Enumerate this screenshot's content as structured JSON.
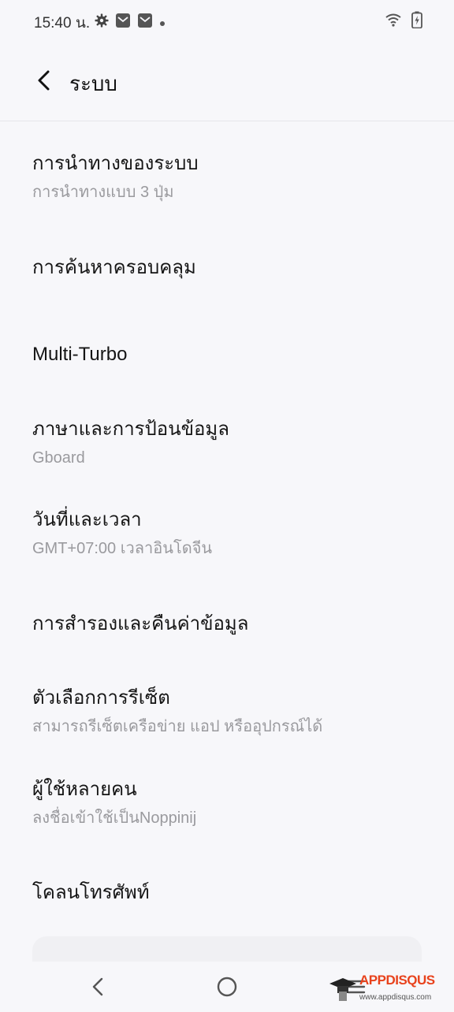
{
  "status_bar": {
    "time": "15:40 น.",
    "icons_left": [
      "gear-icon",
      "mail-icon",
      "mail-icon",
      "dot-icon"
    ],
    "icons_right": [
      "wifi-icon",
      "battery-charging-icon"
    ]
  },
  "header": {
    "back_icon": "chevron-left-icon",
    "title": "ระบบ"
  },
  "settings": [
    {
      "title": "การนำทางของระบบ",
      "subtitle": "การนำทางแบบ 3 ปุ่ม"
    },
    {
      "title": "การค้นหาครอบคลุม",
      "subtitle": ""
    },
    {
      "title": "Multi-Turbo",
      "subtitle": ""
    },
    {
      "title": "ภาษาและการป้อนข้อมูล",
      "subtitle": "Gboard"
    },
    {
      "title": "วันที่และเวลา",
      "subtitle": "GMT+07:00 เวลาอินโดจีน"
    },
    {
      "title": "การสำรองและคืนค่าข้อมูล",
      "subtitle": ""
    },
    {
      "title": "ตัวเลือกการรีเซ็ต",
      "subtitle": "สามารถรีเซ็ตเครือข่าย แอป หรืออุปกรณ์ได้"
    },
    {
      "title": "ผู้ใช้หลายคน",
      "subtitle": "ลงชื่อเข้าใช้เป็นNoppinij"
    },
    {
      "title": "โคลนโทรศัพท์",
      "subtitle": ""
    }
  ],
  "nav_bar": {
    "back": "back-triangle-icon",
    "home": "home-circle-icon",
    "recents": "menu-lines-icon"
  },
  "watermark": {
    "brand": "APPDISQUS",
    "url": "www.appdisqus.com"
  }
}
